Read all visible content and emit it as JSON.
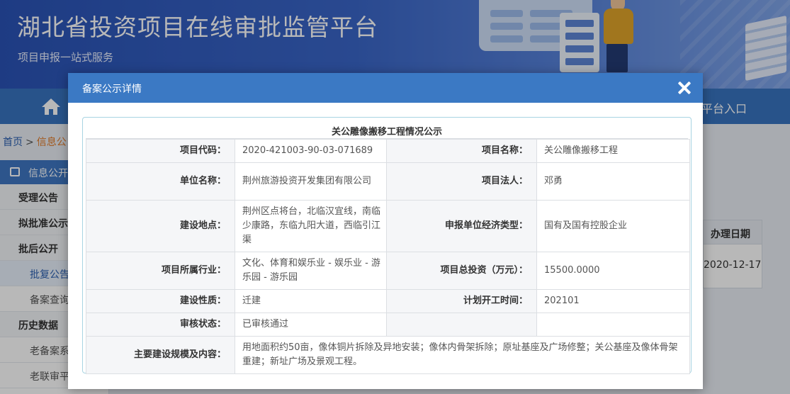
{
  "banner": {
    "title": "湖北省投资项目在线审批监管平台",
    "subtitle": "项目申报一站式服务"
  },
  "nav": {
    "right_entry": "平台入口"
  },
  "breadcrumb": {
    "home": "首页",
    "sep": ">",
    "current": "信息公"
  },
  "sidebar": {
    "header": "信息公开",
    "items": [
      {
        "label": "受理公告"
      },
      {
        "label": "拟批准公示"
      },
      {
        "label": "批后公开"
      },
      {
        "label": "批复公告"
      },
      {
        "label": "备案查询"
      },
      {
        "label": "历史数据"
      },
      {
        "label": "老备案系"
      },
      {
        "label": "老联审平"
      }
    ]
  },
  "background_table": {
    "col_header": "办理日期",
    "cell": "2020-12-17"
  },
  "modal": {
    "title": "备案公示详情",
    "panel_title": "关公雕像搬移工程情况公示",
    "rows": {
      "project_code_label": "项目代码：",
      "project_code": "2020-421003-90-03-071689",
      "project_name_label": "项目名称：",
      "project_name": "关公雕像搬移工程",
      "unit_name_label": "单位名称：",
      "unit_name": "荆州旅游投资开发集团有限公司",
      "legal_person_label": "项目法人：",
      "legal_person": "邓勇",
      "location_label": "建设地点：",
      "location": "荆州区点将台，北临汉宜线，南临少康路，东临九阳大道，西临引江渠",
      "econ_type_label": "申报单位经济类型：",
      "econ_type": "国有及国有控股企业",
      "industry_label": "项目所属行业：",
      "industry": "文化、体育和娱乐业 - 娱乐业 - 游乐园 - 游乐园",
      "total_invest_label": "项目总投资（万元）：",
      "total_invest": "15500.0000",
      "nature_label": "建设性质：",
      "nature": "迁建",
      "start_time_label": "计划开工时间：",
      "start_time": "202101",
      "review_label": "审核状态：",
      "review": "已审核通过",
      "scope_label": "主要建设规模及内容：",
      "scope": "用地面积约50亩，像体铜片拆除及异地安装；像体内骨架拆除；原址基座及广场修整；关公基座及像体骨架重建；新址广场及景观工程。"
    }
  },
  "colors": {
    "modal_header": "#3b79c4",
    "nav": "#3873c0",
    "panel_border": "#a8d4e2"
  }
}
